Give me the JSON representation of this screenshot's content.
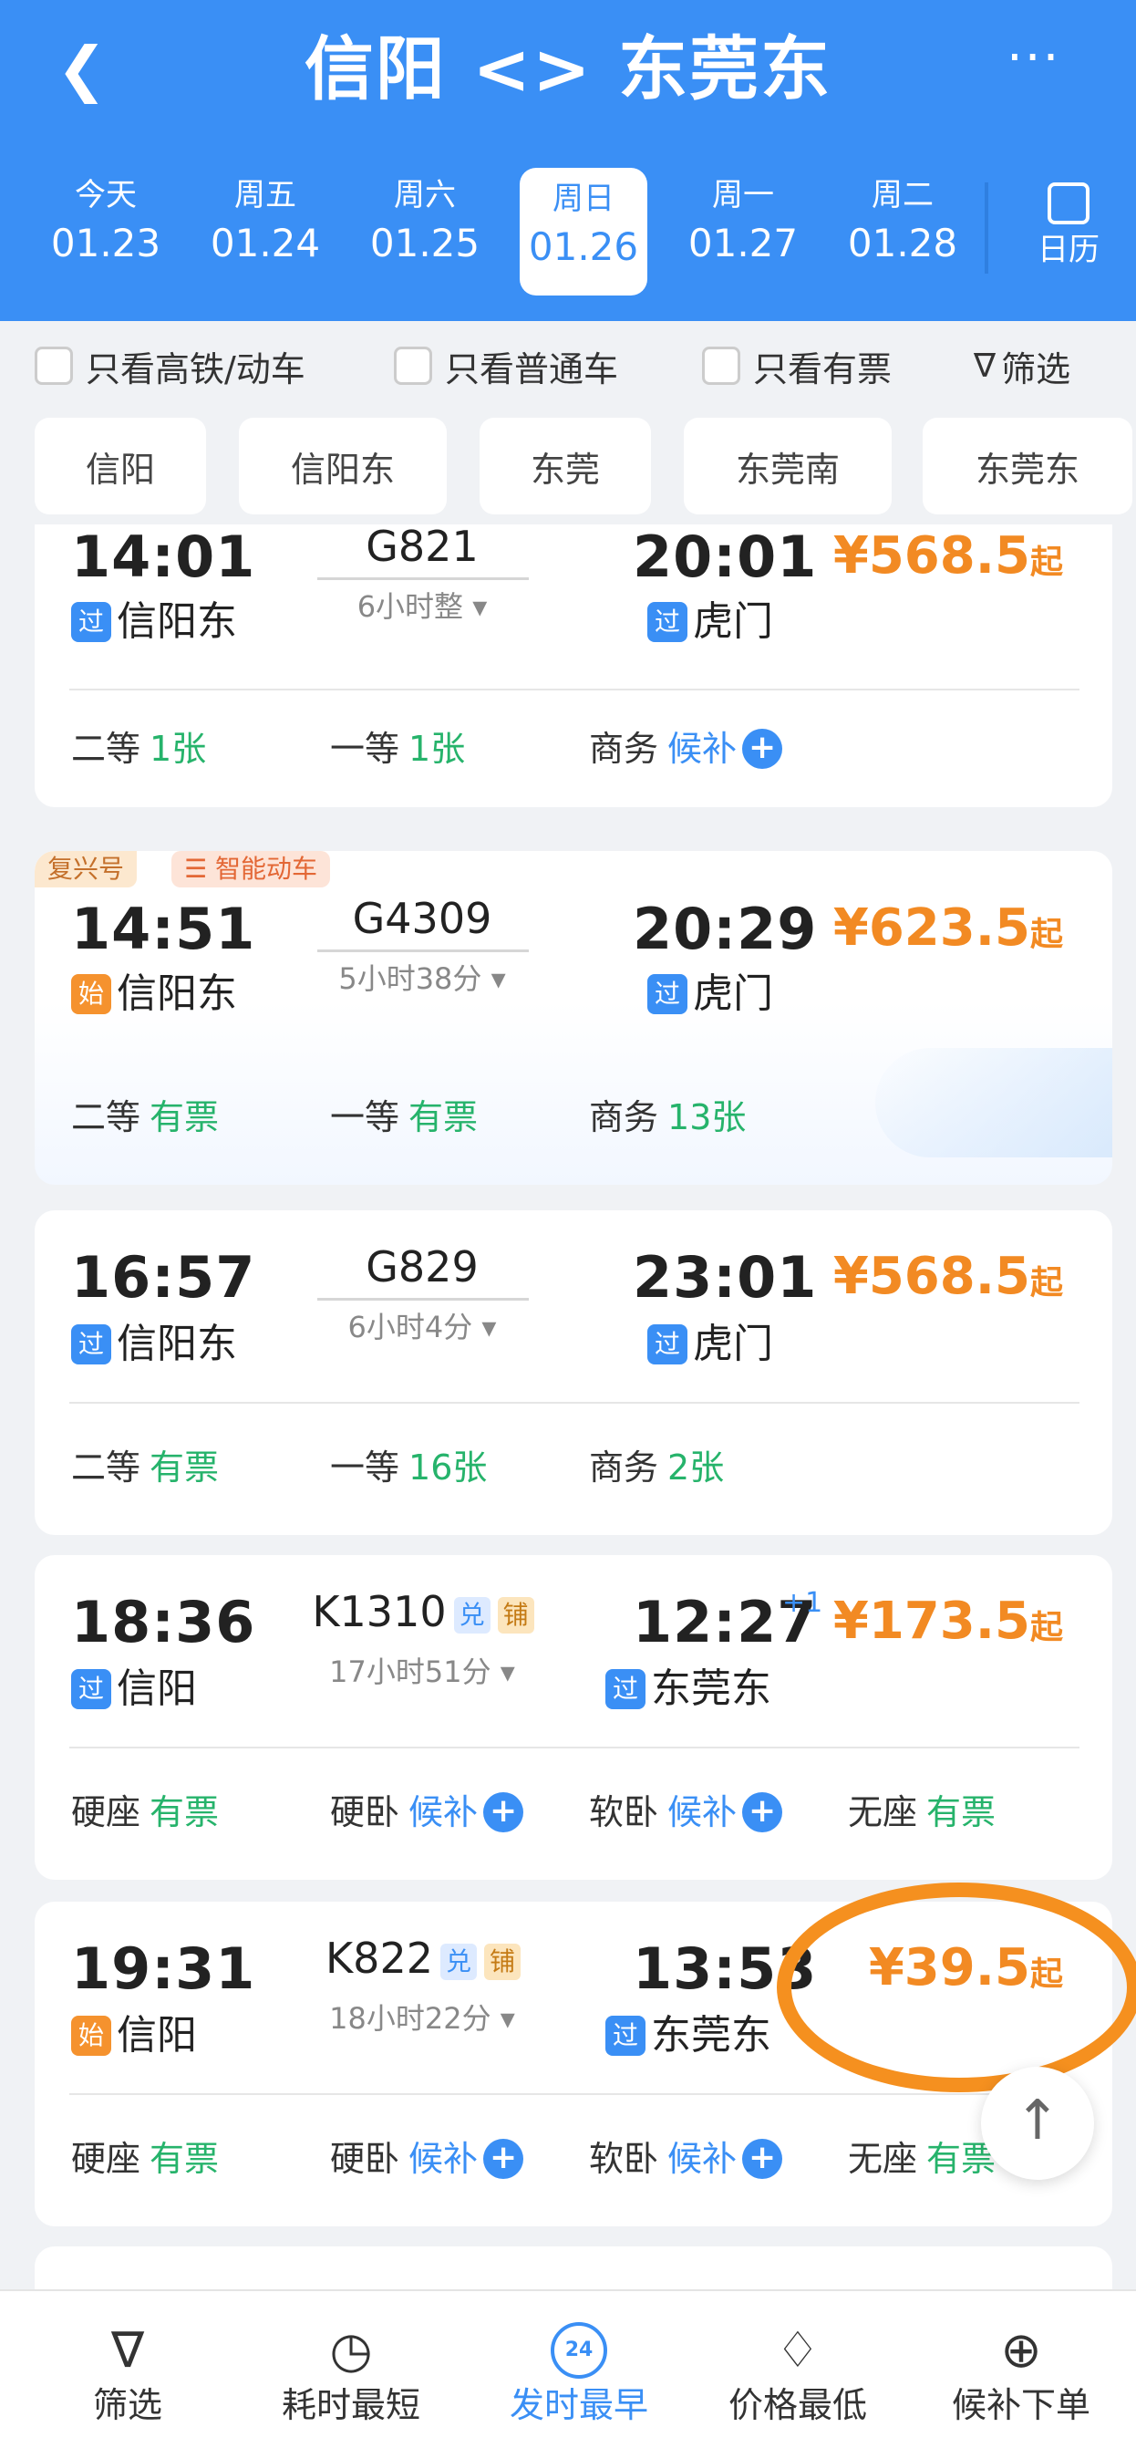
{
  "header": {
    "back_icon": "chevron-left-icon",
    "title": "信阳 <> 东莞东",
    "more_icon": "more-dots-icon",
    "bg_color": "#3a8ff5"
  },
  "dates": [
    {
      "weekday": "今天",
      "date": "01.23"
    },
    {
      "weekday": "周五",
      "date": "01.24"
    },
    {
      "weekday": "周六",
      "date": "01.25"
    },
    {
      "weekday": "周日",
      "date": "01.26",
      "active": true
    },
    {
      "weekday": "周一",
      "date": "01.27"
    },
    {
      "weekday": "周二",
      "date": "01.28"
    }
  ],
  "calendar": {
    "label": "日历",
    "icon": "calendar-icon"
  },
  "filters": {
    "high_speed": "只看高铁/动车",
    "normal": "只看普通车",
    "available": "只看有票",
    "filter": "筛选"
  },
  "stations": [
    "信阳",
    "信阳东",
    "东莞",
    "东莞南",
    "东莞东"
  ],
  "trains": [
    {
      "dep_time": "14:01",
      "train_no": "G821",
      "duration": "6小时整",
      "arr_time": "20:01",
      "dep_tag": "过",
      "dep_station": "信阳东",
      "arr_tag": "过",
      "arr_station": "虎门",
      "price": "¥568.5",
      "price_suffix": "起",
      "seats": [
        {
          "name": "二等",
          "value": "1张"
        },
        {
          "name": "一等",
          "value": "1张"
        },
        {
          "name": "商务",
          "value": "候补",
          "waitlist": true
        }
      ]
    },
    {
      "badges": [
        "复兴号",
        "智能动车"
      ],
      "dep_time": "14:51",
      "train_no": "G4309",
      "duration": "5小时38分",
      "arr_time": "20:29",
      "dep_tag": "始",
      "dep_station": "信阳东",
      "arr_tag": "过",
      "arr_station": "虎门",
      "price": "¥623.5",
      "price_suffix": "起",
      "seats": [
        {
          "name": "二等",
          "value": "有票"
        },
        {
          "name": "一等",
          "value": "有票"
        },
        {
          "name": "商务",
          "value": "13张"
        }
      ]
    },
    {
      "dep_time": "16:57",
      "train_no": "G829",
      "duration": "6小时4分",
      "arr_time": "23:01",
      "dep_tag": "过",
      "dep_station": "信阳东",
      "arr_tag": "过",
      "arr_station": "虎门",
      "price": "¥568.5",
      "price_suffix": "起",
      "seats": [
        {
          "name": "二等",
          "value": "有票"
        },
        {
          "name": "一等",
          "value": "16张"
        },
        {
          "name": "商务",
          "value": "2张"
        }
      ]
    },
    {
      "dep_time": "18:36",
      "train_no": "K1310",
      "tag1": "兑",
      "tag2": "铺",
      "duration": "17小时51分",
      "arr_time": "12:27",
      "arr_day": "+1",
      "dep_tag": "过",
      "dep_station": "信阳",
      "arr_tag": "过",
      "arr_station": "东莞东",
      "price": "¥173.5",
      "price_suffix": "起",
      "seats": [
        {
          "name": "硬座",
          "value": "有票"
        },
        {
          "name": "硬卧",
          "value": "候补",
          "waitlist": true
        },
        {
          "name": "软卧",
          "value": "候补",
          "waitlist": true
        },
        {
          "name": "无座",
          "value": "有票"
        }
      ]
    },
    {
      "dep_time": "19:31",
      "train_no": "K822",
      "tag1": "兑",
      "tag2": "铺",
      "duration": "18小时22分",
      "arr_time": "13:53",
      "dep_tag": "始",
      "dep_station": "信阳",
      "arr_tag": "过",
      "arr_station": "东莞东",
      "price": "¥39.5",
      "price_suffix": "起",
      "seats": [
        {
          "name": "硬座",
          "value": "有票"
        },
        {
          "name": "硬卧",
          "value": "候补",
          "waitlist": true
        },
        {
          "name": "软卧",
          "value": "候补",
          "waitlist": true
        },
        {
          "name": "无座",
          "value": "有票"
        }
      ]
    }
  ],
  "tabbar": [
    {
      "label": "筛选",
      "icon": "filter-icon"
    },
    {
      "label": "耗时最短",
      "icon": "timer-icon"
    },
    {
      "label": "发时最早",
      "icon": "clock-24-icon",
      "icon_text": "24",
      "active": true
    },
    {
      "label": "价格最低",
      "icon": "price-tag-icon"
    },
    {
      "label": "候补下单",
      "icon": "cart-plus-icon"
    }
  ],
  "colors": {
    "accent": "#3a8ff5",
    "price": "#f28a23",
    "available": "#26b36b",
    "highlight_circle": "#f5901f"
  }
}
